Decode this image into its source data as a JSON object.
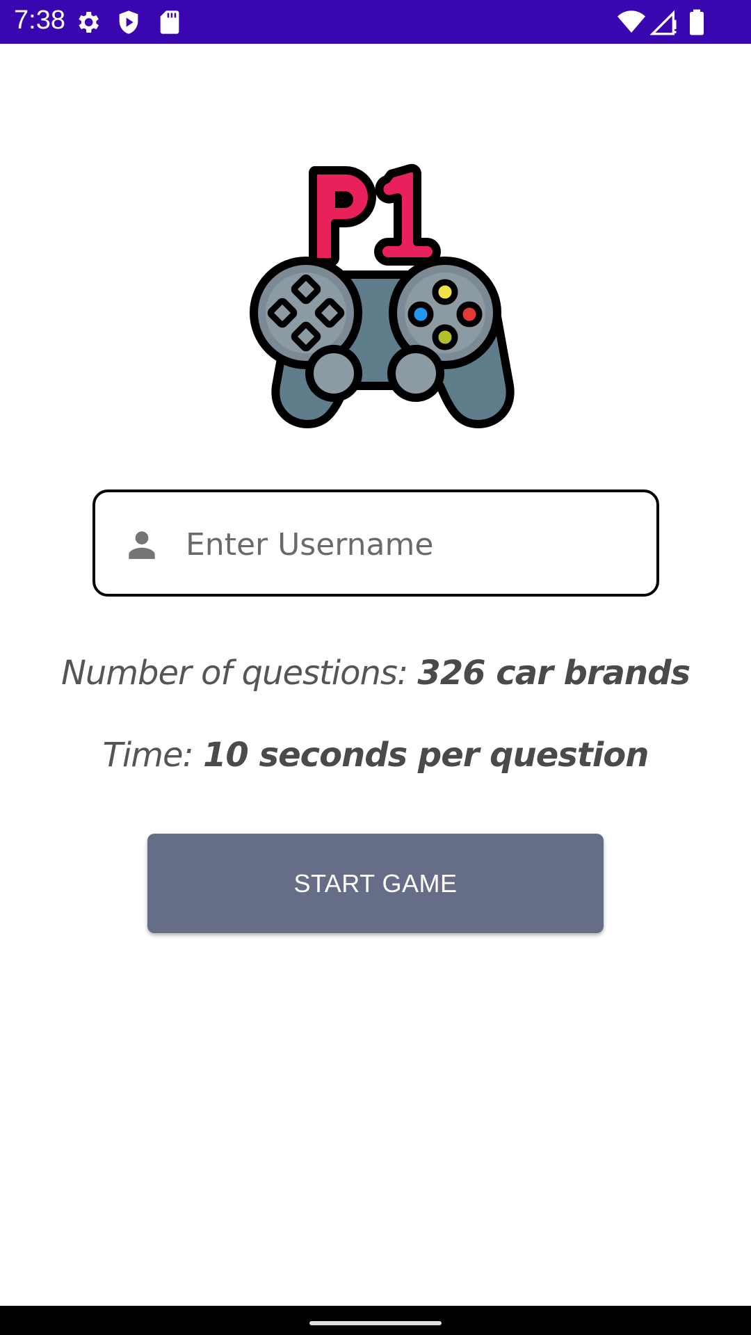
{
  "status_bar": {
    "time": "7:38",
    "left_icons": [
      "settings-icon",
      "shield-play-icon",
      "sd-card-icon"
    ],
    "right_icons": [
      "wifi-icon",
      "signal-icon",
      "battery-icon"
    ],
    "background_color": "#3a06b0"
  },
  "logo": {
    "text": "P1",
    "icon": "gamepad-icon",
    "text_color": "#e8215a",
    "body_color": "#607d8b"
  },
  "username": {
    "placeholder": "Enter Username",
    "value": "",
    "icon": "person-icon"
  },
  "info": {
    "questions_label": "Number of questions:",
    "questions_value": "326 car brands",
    "time_label": "Time:",
    "time_value": "10 seconds per question"
  },
  "actions": {
    "start_label": "START GAME",
    "button_color": "#666e87"
  }
}
